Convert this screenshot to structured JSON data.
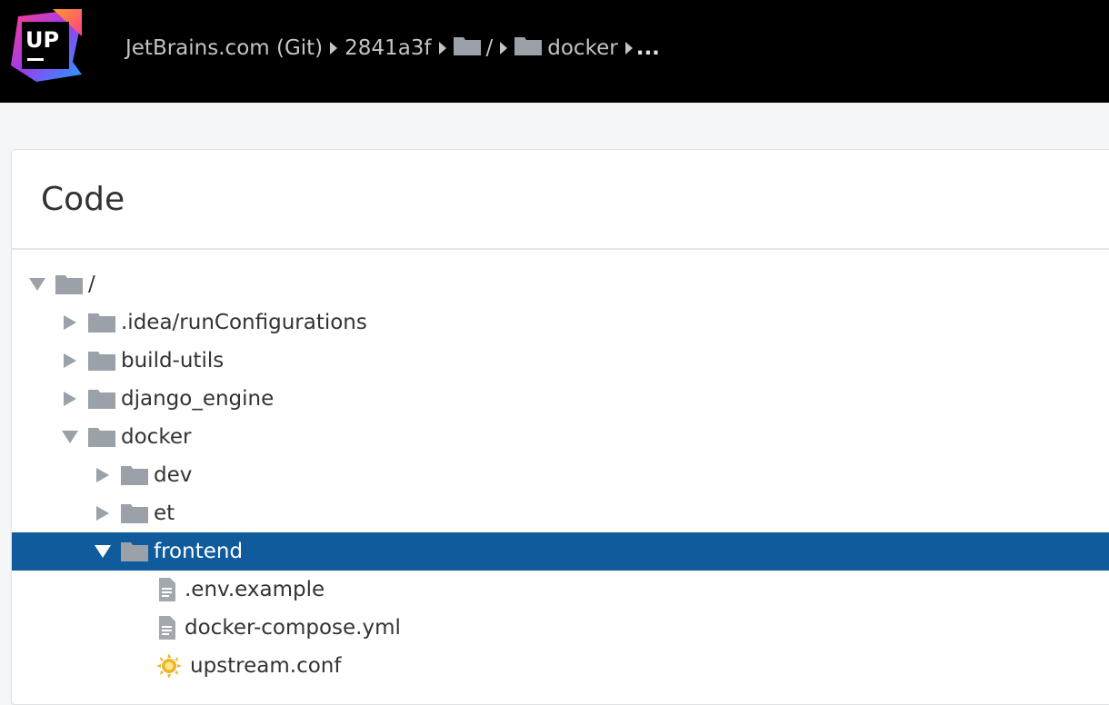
{
  "header": {
    "logo_text": "UP",
    "breadcrumb": {
      "project": "JetBrains.com (Git)",
      "revision": "2841a3f",
      "root": "/",
      "folder": "docker",
      "ellipsis": "..."
    }
  },
  "panel": {
    "title": "Code"
  },
  "tree": {
    "root": {
      "label": "/",
      "expanded": true
    },
    "items": [
      {
        "label": ".idea/runConfigurations",
        "type": "folder",
        "expanded": false
      },
      {
        "label": "build-utils",
        "type": "folder",
        "expanded": false
      },
      {
        "label": "django_engine",
        "type": "folder",
        "expanded": false
      },
      {
        "label": "docker",
        "type": "folder",
        "expanded": true
      },
      {
        "label": "dev",
        "type": "folder",
        "expanded": false
      },
      {
        "label": "et",
        "type": "folder",
        "expanded": false
      },
      {
        "label": "frontend",
        "type": "folder",
        "expanded": true,
        "selected": true
      },
      {
        "label": ".env.example",
        "type": "file"
      },
      {
        "label": "docker-compose.yml",
        "type": "file"
      },
      {
        "label": "upstream.conf",
        "type": "config-file"
      }
    ]
  },
  "colors": {
    "topbar": "#000000",
    "selection": "#0f5b9c",
    "folder": "#9aa1a8"
  }
}
